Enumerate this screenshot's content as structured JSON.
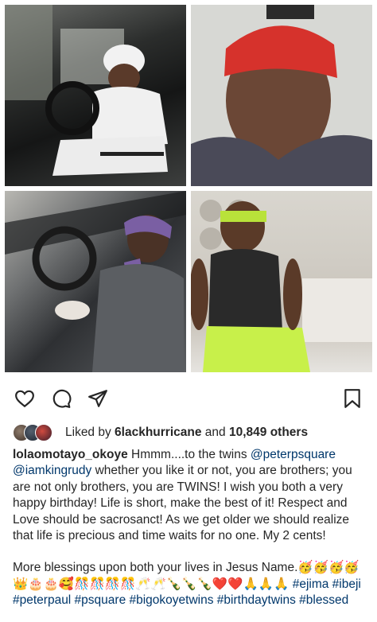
{
  "post": {
    "images": [
      {
        "name": "photo-man-in-car-white-tracksuit",
        "colors": [
          "#2b2d2c",
          "#f1f1f1"
        ]
      },
      {
        "name": "photo-man-red-bandana-selfie",
        "colors": [
          "#d6322c",
          "#6a4a3a"
        ]
      },
      {
        "name": "photo-man-purple-headband-in-car",
        "colors": [
          "#7a5fa3",
          "#5b5e62"
        ]
      },
      {
        "name": "photo-man-green-headband-on-bed",
        "colors": [
          "#b9e23a",
          "#2a2a2a"
        ]
      }
    ]
  },
  "actions": {
    "like_icon": "heart-icon",
    "comment_icon": "comment-icon",
    "share_icon": "paper-plane-icon",
    "save_icon": "bookmark-icon"
  },
  "likes": {
    "prefix": "Liked by ",
    "user": "6lackhurricane",
    "connector": " and ",
    "others": "10,849 others"
  },
  "caption": {
    "username": "lolaomotayo_okoye",
    "text_1": " Hmmm....to the twins ",
    "mention_1": "@peterpsquare",
    "mention_2": "@iamkingrudy",
    "text_2": " whether you like it or not, you are brothers; you are not only brothers, you are TWINS! I wish you both a very happy birthday! Life is short, make the best of it! Respect and Love should be sacrosanct! As we get older we should realize that life is precious and time waits for no one. My 2 cents!",
    "text_3": "More blessings upon both your lives in Jesus Name.",
    "emojis_1": "🥳🥳🥳🥳",
    "emojis_2": "👑🎂🎂🥰🎊🎊🎊🎊🥂🥂🍾🍾🍾❤️❤️🙏🙏🙏",
    "hashtags_1": " #ejima #ibeji",
    "hashtags_2": "#peterpaul #psquare #bigokoyetwins #birthdaytwins #blessed"
  }
}
